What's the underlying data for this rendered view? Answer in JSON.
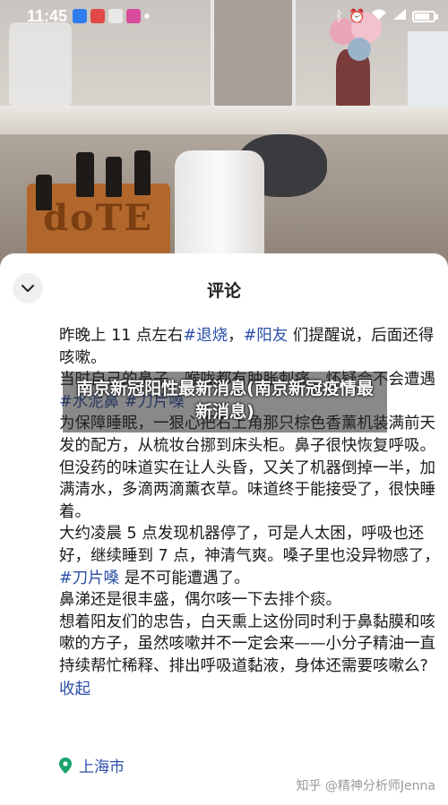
{
  "status_bar": {
    "time": "11:45",
    "battery_percent": 80,
    "right_icons": [
      "bluetooth-icon",
      "alarm-icon",
      "wifi-icon",
      "signal-icon",
      "battery-icon"
    ]
  },
  "sheet": {
    "title": "评论",
    "collapse_icon": "chevron-down-icon"
  },
  "comment": {
    "paragraphs": [
      [
        {
          "t": "昨晚上 11 点左右"
        },
        {
          "t": "#退烧",
          "tag": true
        },
        {
          "t": "，"
        },
        {
          "t": "#阳友",
          "tag": true
        },
        {
          "t": " 们提醒说，后面还得咳嗽。"
        }
      ],
      [
        {
          "t": "当时自己的鼻子、喉咙都有肿胀刺痛，怀疑会不会遭遇"
        },
        {
          "t": "#水泥鼻",
          "tag": true
        },
        {
          "t": " "
        },
        {
          "t": "#刀片嗓",
          "tag": true
        }
      ],
      [
        {
          "t": "为保障睡眠，一狠心把右上角那只棕色香薰机装满前天发的配方，从梳妆台挪到床头柜。鼻子很快恢复呼吸。"
        }
      ],
      [
        {
          "t": "但没药的味道实在让人头昏，又关了机器倒掉一半，加满清水，多滴两滴薰衣草。味道终于能接受了，很快睡着。"
        }
      ],
      [
        {
          "t": "大约凌晨 5 点发现机器停了，可是人太困，呼吸也还好，继续睡到 7 点，神清气爽。嗓子里也没异物感了，"
        },
        {
          "t": "#刀片嗓",
          "tag": true
        },
        {
          "t": " 是不可能遭遇了。"
        }
      ],
      [
        {
          "t": "鼻涕还是很丰盛，偶尔咳一下去排个痰。"
        }
      ],
      [
        {
          "t": "想着阳友们的忠告，白天熏上这份同时利于鼻黏膜和咳嗽的方子，虽然咳嗽并不一定会来——小分子精油一直持续帮忙稀释、排出呼吸道黏液，身体还需要咳嗽么?"
        }
      ]
    ],
    "collapse_label": "收起"
  },
  "location": {
    "label": "上海市",
    "icon": "location-pin-icon",
    "color": "#1aa36b"
  },
  "watermark": "知乎 @精神分析师Jenna",
  "banner": {
    "text": "南京新冠阳性最新消息(南京新冠疫情最新消息)"
  },
  "colors": {
    "tag": "#2c4fa8",
    "sheet_bg": "#ffffff"
  }
}
